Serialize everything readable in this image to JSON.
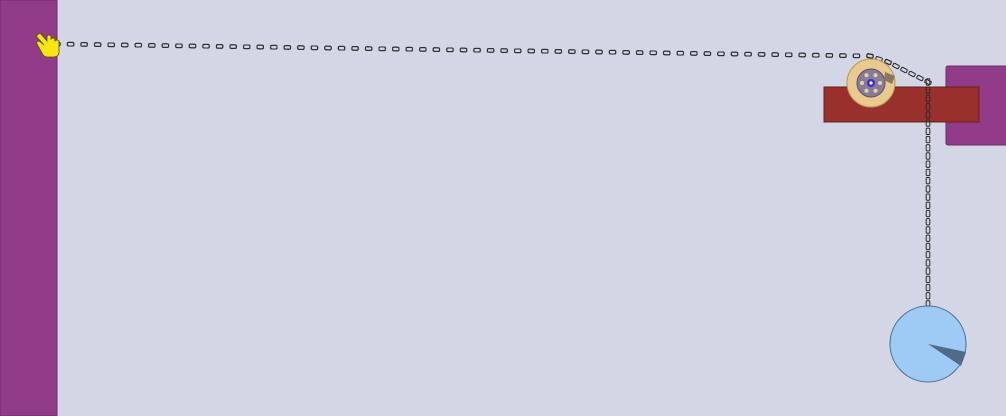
{
  "scene": {
    "background_color": "#d3d6e5",
    "walls": {
      "color": "#923b88",
      "stroke": "#6e2a66"
    },
    "platform": {
      "color": "#9a302c",
      "stroke": "#6a1f1c"
    },
    "pulley": {
      "outer_color": "#e9c98e",
      "inner_color": "#8a7a9a",
      "hub_color": "#3a2fd0"
    },
    "chain": {
      "link_color": "#2b2b2b"
    },
    "ball": {
      "color": "#9ecbf5",
      "stroke": "#4a6a8a",
      "marker_color": "#4f6b86"
    },
    "cursor": {
      "icon": "pointing-hand-icon",
      "color": "#f5e614"
    }
  }
}
